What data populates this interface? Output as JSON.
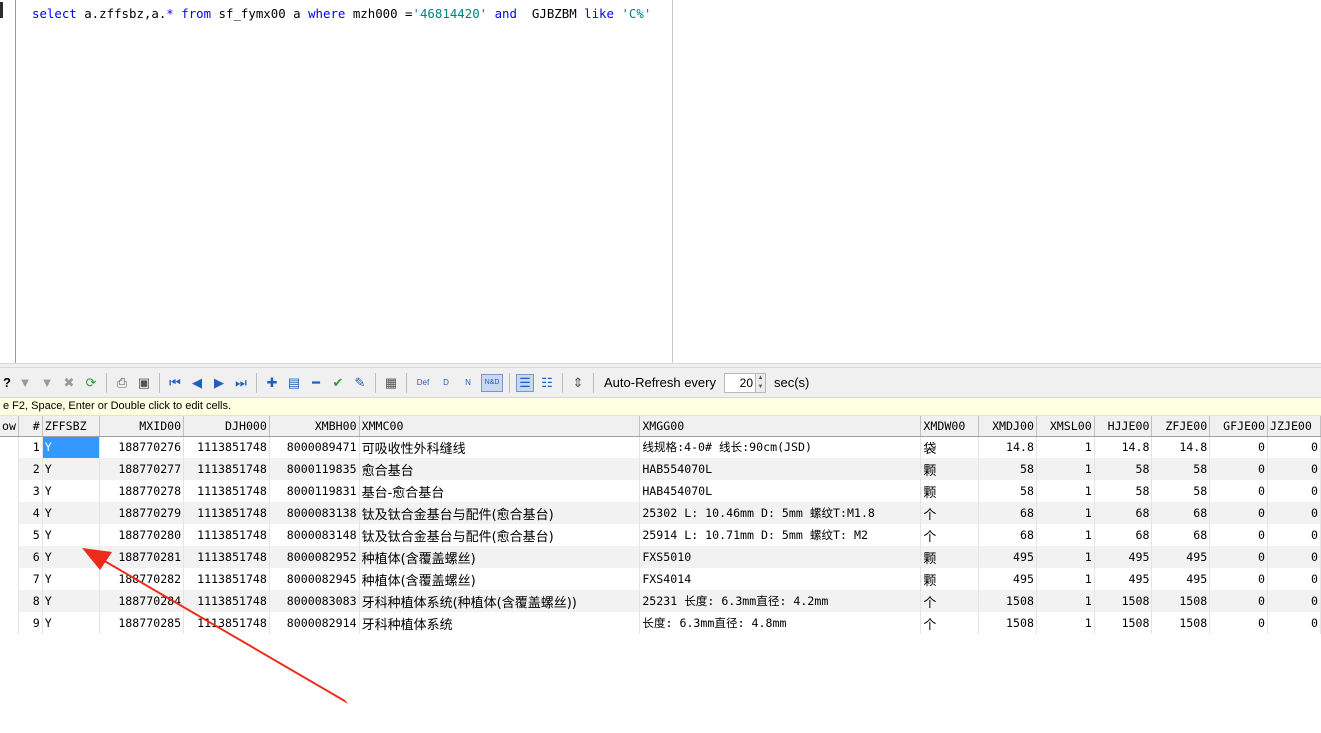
{
  "editor": {
    "sql_tokens": [
      {
        "text": "select",
        "cls": "kw"
      },
      {
        "text": " a.zffsbz,a.",
        "cls": "op"
      },
      {
        "text": "*",
        "cls": "kw"
      },
      {
        "text": " ",
        "cls": "op"
      },
      {
        "text": "from",
        "cls": "kw"
      },
      {
        "text": " sf_fymx00 a ",
        "cls": "op"
      },
      {
        "text": "where",
        "cls": "kw"
      },
      {
        "text": " mzh000 =",
        "cls": "op"
      },
      {
        "text": "'46814420'",
        "cls": "str"
      },
      {
        "text": " ",
        "cls": "op"
      },
      {
        "text": "and",
        "cls": "kw"
      },
      {
        "text": "  GJBZBM ",
        "cls": "op"
      },
      {
        "text": "like",
        "cls": "kw"
      },
      {
        "text": " ",
        "cls": "op"
      },
      {
        "text": "'C%'",
        "cls": "str"
      }
    ]
  },
  "toolbar": {
    "help_label": "?",
    "auto_refresh_label": "Auto-Refresh every",
    "auto_refresh_value": "20",
    "auto_refresh_unit": "sec(s)",
    "def_label": "Def",
    "d_label": "D",
    "n_label": "N",
    "nd_label": "N&D"
  },
  "hint": "e F2, Space, Enter or Double click to edit cells.",
  "grid": {
    "columns": [
      "ow",
      "#",
      "ZFFSBZ",
      "MXID00",
      "DJH000",
      "XMBH00",
      "XMMC00",
      "XMGG00",
      "XMDW00",
      "XMDJ00",
      "XMSL00",
      "HJJE00",
      "ZFJE00",
      "GFJE00",
      "JZJE00"
    ],
    "rows": [
      {
        "n": "1",
        "zffsbz": "Y",
        "mxid": "188770276",
        "djh": "1113851748",
        "xmbh": "8000089471",
        "xmmc": "可吸收性外科缝线",
        "xmgg": "线规格:4-0# 线长:90cm(JSD)",
        "xmdw": "袋",
        "xmdj": "14.8",
        "xmsl": "1",
        "hjje": "14.8",
        "zfje": "14.8",
        "gfje": "0",
        "jzje": "0"
      },
      {
        "n": "2",
        "zffsbz": "Y",
        "mxid": "188770277",
        "djh": "1113851748",
        "xmbh": "8000119835",
        "xmmc": "愈合基台",
        "xmgg": "HAB554070L",
        "xmdw": "颗",
        "xmdj": "58",
        "xmsl": "1",
        "hjje": "58",
        "zfje": "58",
        "gfje": "0",
        "jzje": "0"
      },
      {
        "n": "3",
        "zffsbz": "Y",
        "mxid": "188770278",
        "djh": "1113851748",
        "xmbh": "8000119831",
        "xmmc": "基台-愈合基台",
        "xmgg": "HAB454070L",
        "xmdw": "颗",
        "xmdj": "58",
        "xmsl": "1",
        "hjje": "58",
        "zfje": "58",
        "gfje": "0",
        "jzje": "0"
      },
      {
        "n": "4",
        "zffsbz": "Y",
        "mxid": "188770279",
        "djh": "1113851748",
        "xmbh": "8000083138",
        "xmmc": "钛及钛合金基台与配件(愈合基台)",
        "xmgg": "25302 L: 10.46mm D: 5mm 螺纹T:M1.8",
        "xmdw": "个",
        "xmdj": "68",
        "xmsl": "1",
        "hjje": "68",
        "zfje": "68",
        "gfje": "0",
        "jzje": "0"
      },
      {
        "n": "5",
        "zffsbz": "Y",
        "mxid": "188770280",
        "djh": "1113851748",
        "xmbh": "8000083148",
        "xmmc": "钛及钛合金基台与配件(愈合基台)",
        "xmgg": "25914 L: 10.71mm D: 5mm 螺纹T: M2",
        "xmdw": "个",
        "xmdj": "68",
        "xmsl": "1",
        "hjje": "68",
        "zfje": "68",
        "gfje": "0",
        "jzje": "0"
      },
      {
        "n": "6",
        "zffsbz": "Y",
        "mxid": "188770281",
        "djh": "1113851748",
        "xmbh": "8000082952",
        "xmmc": "种植体(含覆盖螺丝)",
        "xmgg": "FXS5010",
        "xmdw": "颗",
        "xmdj": "495",
        "xmsl": "1",
        "hjje": "495",
        "zfje": "495",
        "gfje": "0",
        "jzje": "0"
      },
      {
        "n": "7",
        "zffsbz": "Y",
        "mxid": "188770282",
        "djh": "1113851748",
        "xmbh": "8000082945",
        "xmmc": "种植体(含覆盖螺丝)",
        "xmgg": "FXS4014",
        "xmdw": "颗",
        "xmdj": "495",
        "xmsl": "1",
        "hjje": "495",
        "zfje": "495",
        "gfje": "0",
        "jzje": "0"
      },
      {
        "n": "8",
        "zffsbz": "Y",
        "mxid": "188770284",
        "djh": "1113851748",
        "xmbh": "8000083083",
        "xmmc": "牙科种植体系统(种植体(含覆盖螺丝))",
        "xmgg": "25231  长度: 6.3mm直径: 4.2mm",
        "xmdw": "个",
        "xmdj": "1508",
        "xmsl": "1",
        "hjje": "1508",
        "zfje": "1508",
        "gfje": "0",
        "jzje": "0"
      },
      {
        "n": "9",
        "zffsbz": "Y",
        "mxid": "188770285",
        "djh": "1113851748",
        "xmbh": "8000082914",
        "xmmc": "牙科种植体系统",
        "xmgg": "长度: 6.3mm直径: 4.8mm",
        "xmdw": "个",
        "xmdj": "1508",
        "xmsl": "1",
        "hjje": "1508",
        "zfje": "1508",
        "gfje": "0",
        "jzje": "0"
      }
    ]
  },
  "colors": {
    "keyword": "#0000ff",
    "string": "#008080",
    "selection": "#3399ff",
    "annotation_arrow": "#ee2a1a"
  }
}
